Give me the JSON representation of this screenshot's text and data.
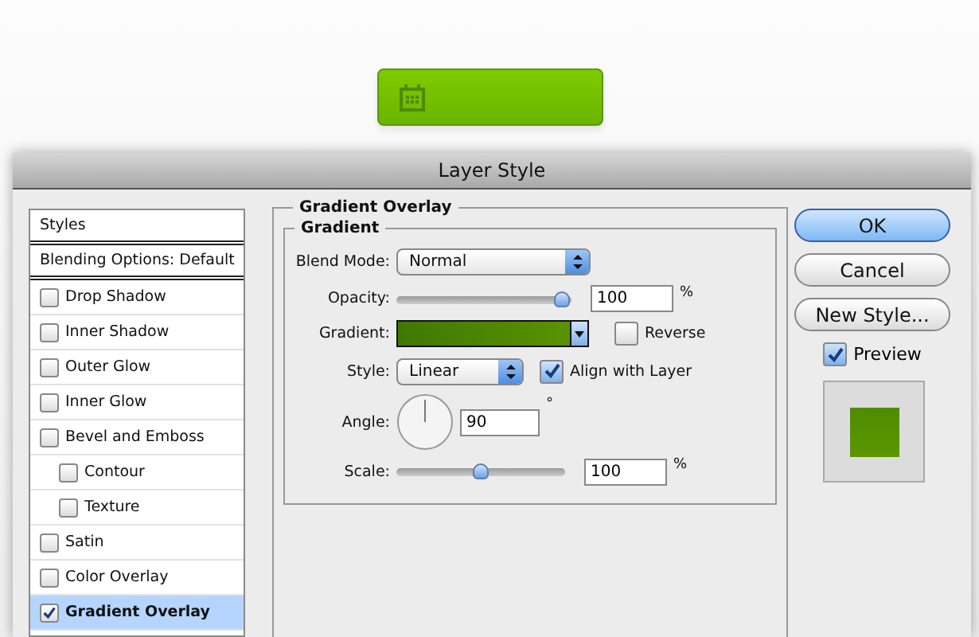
{
  "dialog": {
    "title": "Layer Style"
  },
  "styles": [
    {
      "label": "Styles",
      "kind": "header",
      "selected": false
    },
    {
      "label": "Blending Options: Default",
      "kind": "header",
      "selected": false
    },
    {
      "label": "Drop Shadow",
      "kind": "check",
      "checked": false,
      "selected": false
    },
    {
      "label": "Inner Shadow",
      "kind": "check",
      "checked": false,
      "selected": false
    },
    {
      "label": "Outer Glow",
      "kind": "check",
      "checked": false,
      "selected": false
    },
    {
      "label": "Inner Glow",
      "kind": "check",
      "checked": false,
      "selected": false
    },
    {
      "label": "Bevel and Emboss",
      "kind": "check",
      "checked": false,
      "selected": false,
      "children": [
        {
          "label": "Contour",
          "kind": "check",
          "checked": false,
          "selected": false
        },
        {
          "label": "Texture",
          "kind": "check",
          "checked": false,
          "selected": false
        }
      ]
    },
    {
      "label": "Satin",
      "kind": "check",
      "checked": false,
      "selected": false
    },
    {
      "label": "Color Overlay",
      "kind": "check",
      "checked": false,
      "selected": false
    },
    {
      "label": "Gradient Overlay",
      "kind": "check",
      "checked": true,
      "selected": true
    }
  ],
  "section": {
    "title": "Gradient Overlay",
    "group": "Gradient",
    "blend_mode": {
      "label": "Blend Mode:",
      "value": "Normal"
    },
    "opacity": {
      "label": "Opacity:",
      "level": 1,
      "value": "100",
      "unit": "%"
    },
    "gradient": {
      "label": "Gradient:"
    },
    "reverse": {
      "label": "Reverse",
      "checked": false
    },
    "style": {
      "label": "Style:",
      "value": "Linear"
    },
    "align": {
      "label": "Align with Layer",
      "checked": true
    },
    "angle": {
      "label": "Angle:",
      "value": "90",
      "unit": "°"
    },
    "scale": {
      "label": "Scale:",
      "level": 0.5,
      "value": "100",
      "unit": "%"
    }
  },
  "buttons": [
    {
      "label": "OK",
      "default": true
    },
    {
      "label": "Cancel",
      "default": false
    },
    {
      "label": "New Style...",
      "default": false
    }
  ],
  "preview": {
    "label": "Preview",
    "checked": true
  }
}
